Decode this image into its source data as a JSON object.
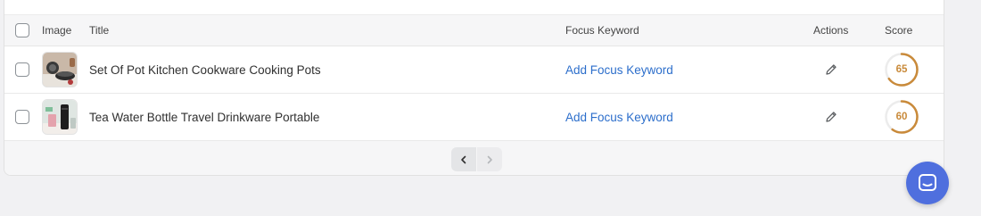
{
  "table": {
    "headers": {
      "image": "Image",
      "title": "Title",
      "focus_keyword": "Focus Keyword",
      "actions": "Actions",
      "score": "Score"
    },
    "rows": [
      {
        "title": "Set Of Pot Kitchen Cookware Cooking Pots",
        "focus_keyword": "Add Focus Keyword",
        "action_icon": "pencil-icon",
        "score": "65",
        "score_fraction": 0.65
      },
      {
        "title": "Tea Water Bottle Travel Drinkware Portable",
        "focus_keyword": "Add Focus Keyword",
        "action_icon": "pencil-icon",
        "score": "60",
        "score_fraction": 0.6
      }
    ]
  },
  "pagination": {
    "prev_icon": "chevron-left-icon",
    "next_icon": "chevron-right-icon"
  },
  "chat": {
    "icon": "chat-icon"
  },
  "colors": {
    "link": "#2c6ecb",
    "score": "#c98a3a",
    "chat": "#4f6fde"
  }
}
